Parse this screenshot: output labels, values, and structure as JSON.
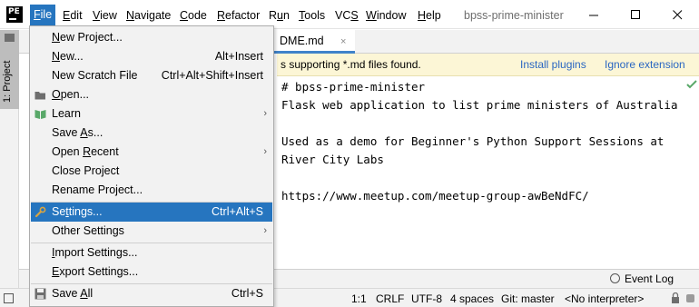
{
  "app": {
    "logo_text": "PE",
    "window_title": "bpss-prime-minister"
  },
  "menubar": {
    "items": [
      {
        "pre": "",
        "mn": "F",
        "post": "ile"
      },
      {
        "pre": "",
        "mn": "E",
        "post": "dit"
      },
      {
        "pre": "",
        "mn": "V",
        "post": "iew"
      },
      {
        "pre": "",
        "mn": "N",
        "post": "avigate"
      },
      {
        "pre": "",
        "mn": "C",
        "post": "ode"
      },
      {
        "pre": "",
        "mn": "R",
        "post": "efactor"
      },
      {
        "pre": "R",
        "mn": "u",
        "post": "n"
      },
      {
        "pre": "",
        "mn": "T",
        "post": "ools"
      },
      {
        "pre": "VC",
        "mn": "S",
        "post": ""
      },
      {
        "pre": "",
        "mn": "W",
        "post": "indow"
      },
      {
        "pre": "",
        "mn": "H",
        "post": "elp"
      }
    ]
  },
  "tool_strip": {
    "project_tab_label": "1: Project"
  },
  "editor_tab": {
    "label": "DME.md",
    "close": "×"
  },
  "banner": {
    "text": "s supporting *.md files found.",
    "install_link": "Install plugins",
    "ignore_link": "Ignore extension"
  },
  "editor": {
    "lines": [
      "# bpss-prime-minister",
      "Flask web application to list prime ministers of Australia",
      "",
      "Used as a demo for Beginner's Python Support Sessions at",
      "River City Labs",
      "",
      "https://www.meetup.com/meetup-group-awBeNdFC/"
    ]
  },
  "event_log": {
    "label": "Event Log"
  },
  "status": {
    "position": "1:1",
    "line_separator": "CRLF",
    "encoding": "UTF-8",
    "indent": "4 spaces",
    "vcs": "Git: master",
    "interpreter": "<No interpreter>"
  },
  "file_menu": {
    "items": [
      {
        "pre": "",
        "mn": "N",
        "post": "ew Project...",
        "shortcut": "",
        "icon": "",
        "submenu": false
      },
      {
        "pre": "",
        "mn": "N",
        "post": "ew...",
        "shortcut": "Alt+Insert",
        "icon": "",
        "submenu": false
      },
      {
        "pre": "New Scratch File",
        "mn": "",
        "post": "",
        "shortcut": "Ctrl+Alt+Shift+Insert",
        "icon": "",
        "submenu": false
      },
      {
        "pre": "",
        "mn": "O",
        "post": "pen...",
        "shortcut": "",
        "icon": "folder-icon",
        "submenu": false
      },
      {
        "pre": "Learn",
        "mn": "",
        "post": "",
        "shortcut": "",
        "icon": "book-icon",
        "submenu": true
      },
      {
        "pre": "Save ",
        "mn": "A",
        "post": "s...",
        "shortcut": "",
        "icon": "",
        "submenu": false
      },
      {
        "pre": "Open ",
        "mn": "R",
        "post": "ecent",
        "shortcut": "",
        "icon": "",
        "submenu": true
      },
      {
        "pre": "Close Pro",
        "mn": "j",
        "post": "ect",
        "shortcut": "",
        "icon": "",
        "submenu": false
      },
      {
        "pre": "Rename Project...",
        "mn": "",
        "post": "",
        "shortcut": "",
        "icon": "",
        "submenu": false
      },
      {
        "pre": "Se",
        "mn": "t",
        "post": "tings...",
        "shortcut": "Ctrl+Alt+S",
        "icon": "wrench-icon",
        "submenu": false
      },
      {
        "pre": "Other Settings",
        "mn": "",
        "post": "",
        "shortcut": "",
        "icon": "",
        "submenu": true
      },
      {
        "pre": "",
        "mn": "I",
        "post": "mport Settings...",
        "shortcut": "",
        "icon": "",
        "submenu": false
      },
      {
        "pre": "",
        "mn": "E",
        "post": "xport Settings...",
        "shortcut": "",
        "icon": "",
        "submenu": false
      },
      {
        "pre": "Save ",
        "mn": "A",
        "post": "ll",
        "shortcut": "Ctrl+S",
        "icon": "save-icon",
        "submenu": false
      }
    ]
  },
  "colors": {
    "selection": "#2675bf",
    "banner_bg": "#fcf6d6",
    "link": "#2a66c2",
    "check": "#59a869"
  }
}
